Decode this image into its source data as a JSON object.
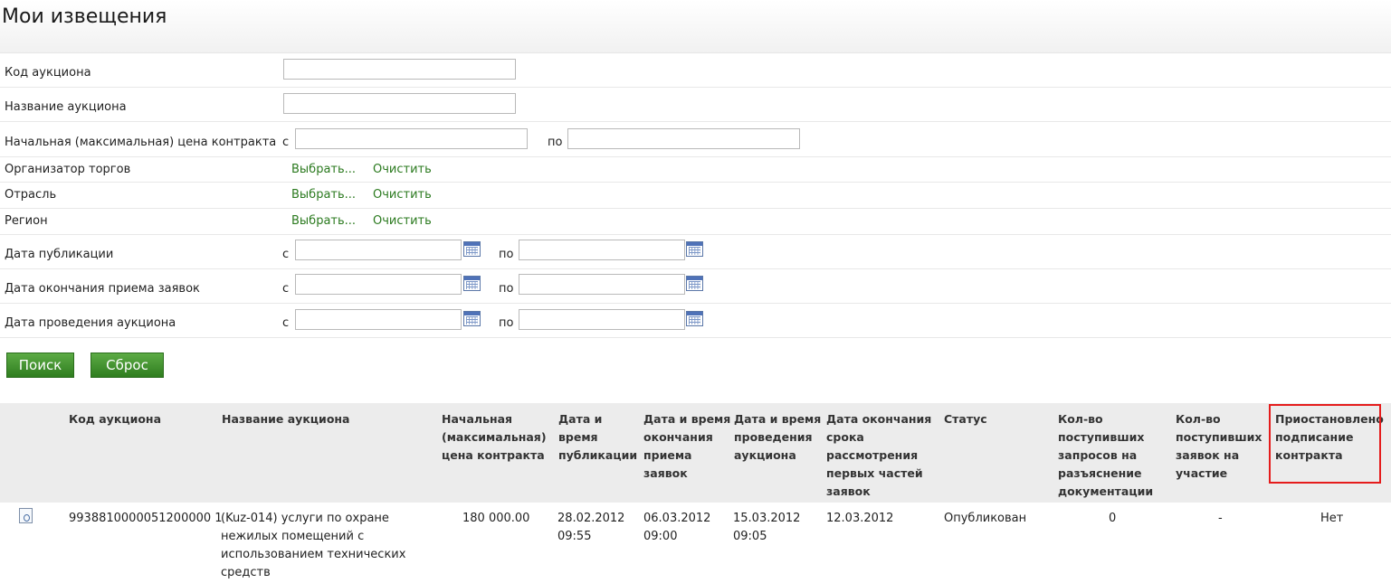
{
  "page": {
    "title": "Мои извещения"
  },
  "filters": {
    "auction_code_label": "Код аукциона",
    "auction_name_label": "Название аукциона",
    "price_label": "Начальная (максимальная) цена контракта",
    "from": "с",
    "to": "по",
    "organizer_label": "Организатор торгов",
    "industry_label": "Отрасль",
    "region_label": "Регион",
    "choose": "Выбрать...",
    "clear": "Очистить",
    "pub_date_label": "Дата публикации",
    "app_end_label": "Дата окончания приема заявок",
    "auction_date_label": "Дата проведения аукциона"
  },
  "buttons": {
    "search": "Поиск",
    "reset": "Сброс"
  },
  "table": {
    "headers": {
      "code": "Код аукциона",
      "name": "Название аукциона",
      "price": [
        "Начальная",
        "(максимальная)",
        "цена контракта"
      ],
      "pub": [
        "Дата и",
        "время",
        "публикации"
      ],
      "app_end": [
        "Дата и время",
        "окончания",
        "приема",
        "заявок"
      ],
      "auction": [
        "Дата и время",
        "проведения",
        "аукциона"
      ],
      "review_end": [
        "Дата окончания",
        "срока",
        "рассмотрения",
        "первых частей",
        "заявок"
      ],
      "status": "Статус",
      "requests": [
        "Кол-во",
        "поступивших",
        "запросов на",
        "разъяснение",
        "документации"
      ],
      "applications": [
        "Кол-во",
        "поступивших",
        "заявок на",
        "участие"
      ],
      "suspended": [
        "Приостановлено",
        "подписание",
        "контракта"
      ]
    },
    "rows": [
      {
        "code": "9938810000051200000 1",
        "name": [
          "(Kuz-014) услуги по охране",
          "нежилых помещений с",
          "использованием технических",
          "средств"
        ],
        "price": "180 000.00",
        "pub": [
          "28.02.2012",
          "09:55"
        ],
        "app_end": [
          "06.03.2012",
          "09:00"
        ],
        "auction": [
          "15.03.2012",
          "09:05"
        ],
        "review_end": "12.03.2012",
        "status": "Опубликован",
        "requests": "0",
        "applications": "-",
        "suspended": "Нет"
      }
    ]
  },
  "icons": {
    "calendar": "calendar-icon",
    "document": "document-icon"
  },
  "colors": {
    "accent_green": "#2f7d1f",
    "link_green": "#2b7a1f",
    "highlight_red": "#e51c1c"
  }
}
